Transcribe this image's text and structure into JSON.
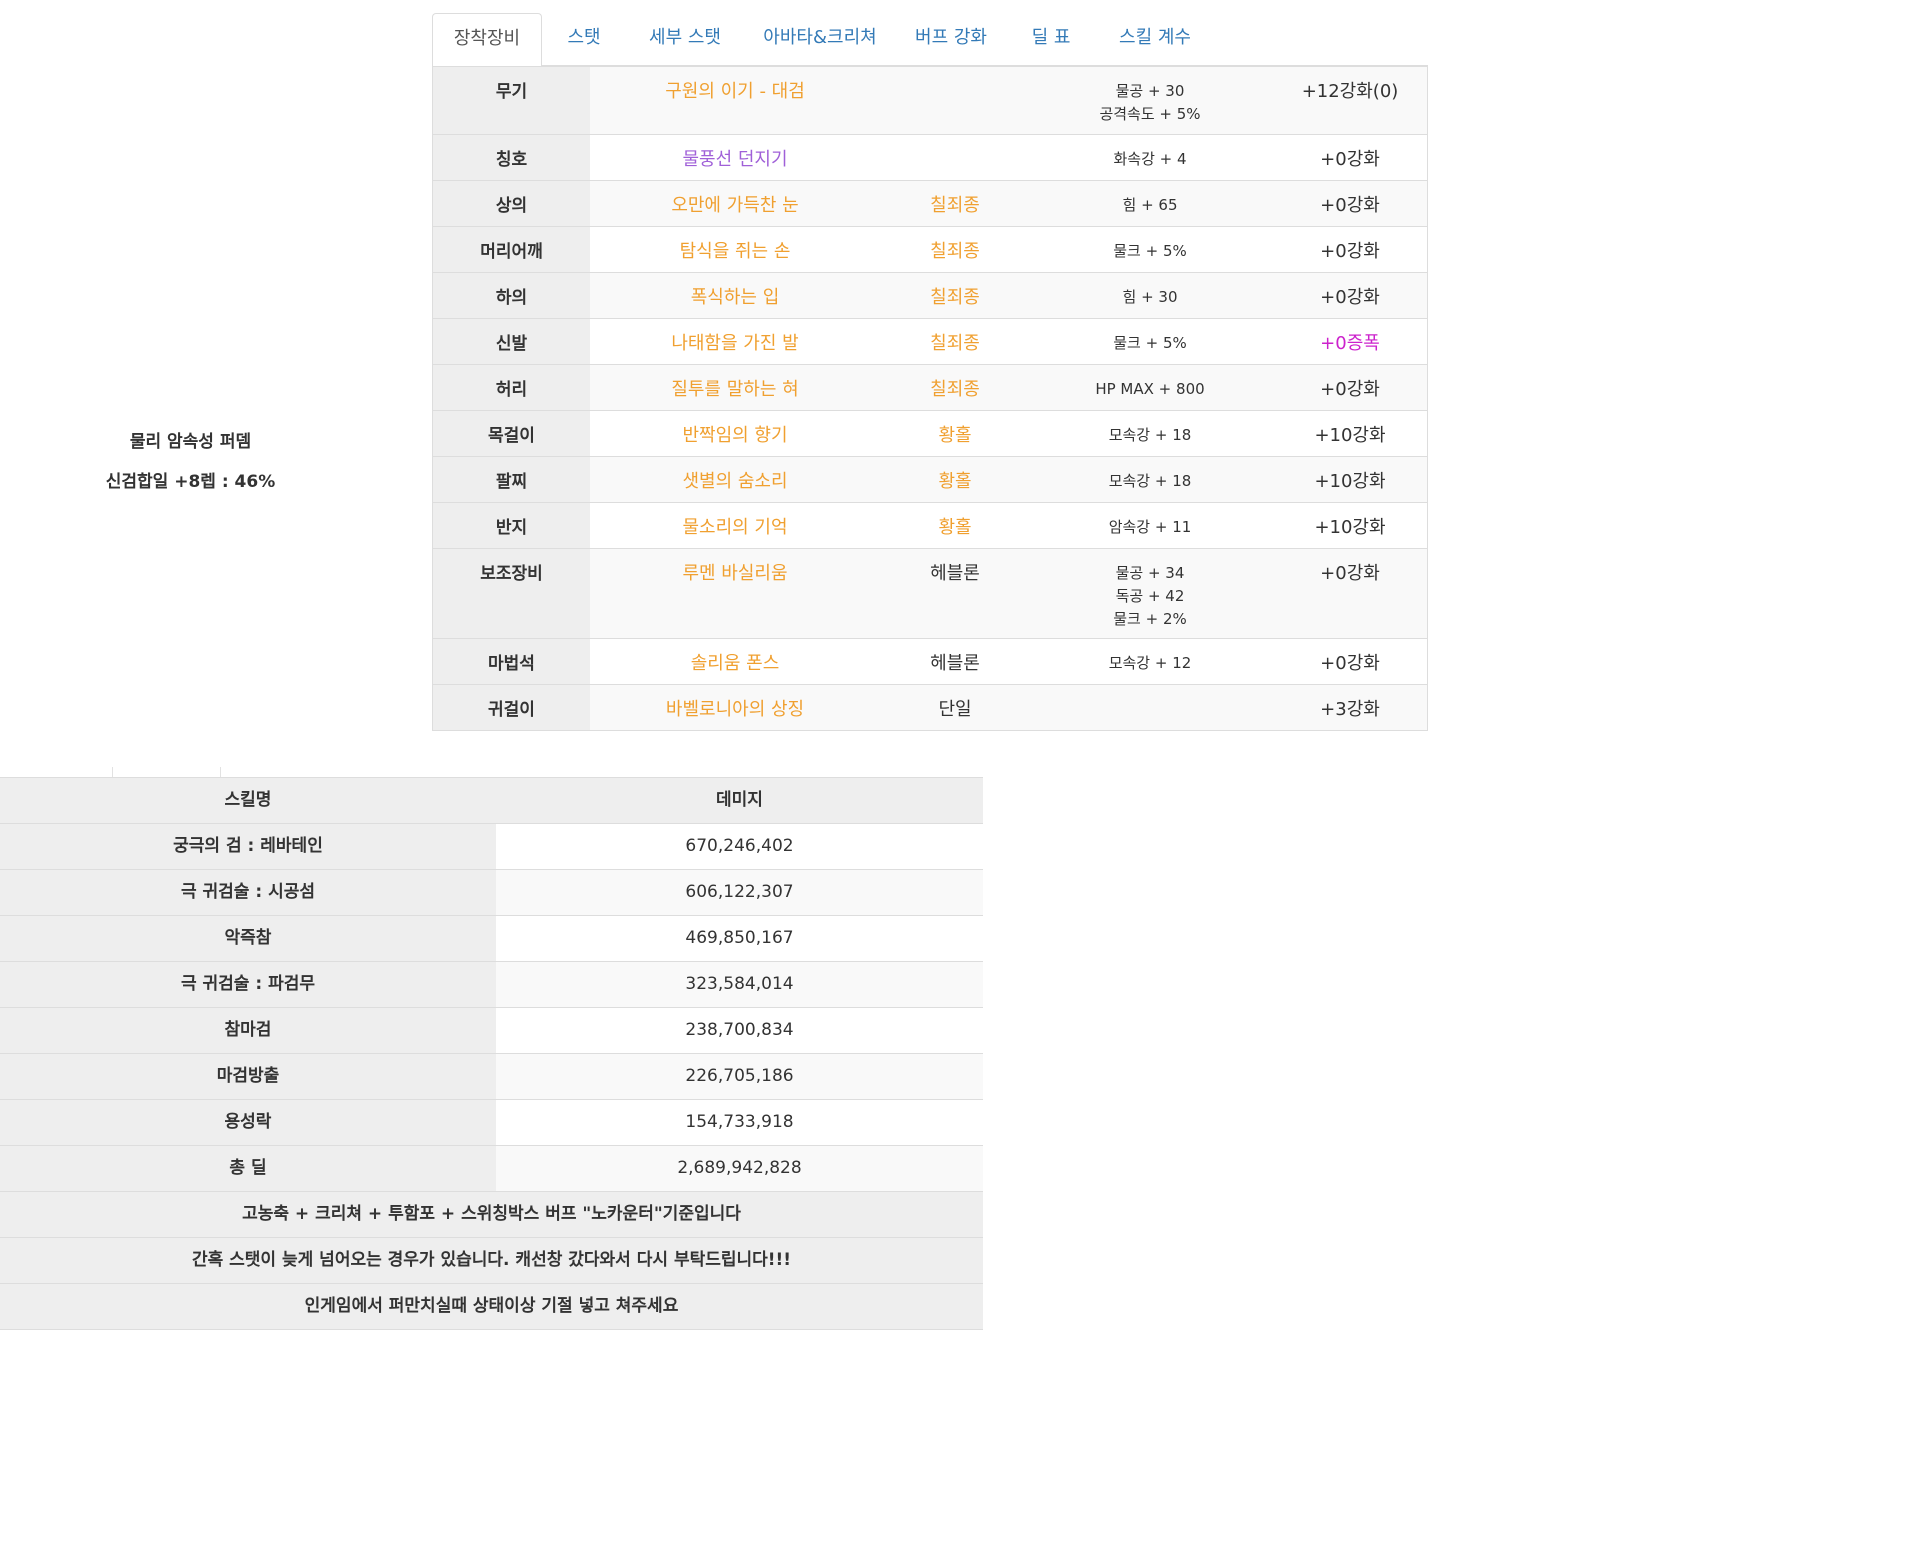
{
  "side_info": {
    "line1": "물리 암속성 퍼뎀",
    "line2": "신검합일 +8렙 : 46%"
  },
  "tabs": [
    {
      "label": "장착장비",
      "active": true
    },
    {
      "label": "스탯",
      "active": false
    },
    {
      "label": "세부 스탯",
      "active": false
    },
    {
      "label": "아바타&크리쳐",
      "active": false
    },
    {
      "label": "버프 강화",
      "active": false
    },
    {
      "label": "딜 표",
      "active": false
    },
    {
      "label": "스킬 계수",
      "active": false
    }
  ],
  "equipment": [
    {
      "slot": "무기",
      "name": "구원의 이기 - 대검",
      "name_color": "#f0a030",
      "set": "",
      "stats": [
        "물공 + 30",
        "공격속도 + 5%"
      ],
      "upgrade": "+12강화(0)",
      "upgrade_color": "#333333"
    },
    {
      "slot": "칭호",
      "name": "물풍선 던지기",
      "name_color": "#a060d8",
      "set": "",
      "stats": [
        "화속강 + 4"
      ],
      "upgrade": "+0강화",
      "upgrade_color": "#333333"
    },
    {
      "slot": "상의",
      "name": "오만에 가득찬 눈",
      "name_color": "#f0a030",
      "set": "칠죄종",
      "set_color": "#f0a030",
      "stats": [
        "힘 + 65"
      ],
      "upgrade": "+0강화",
      "upgrade_color": "#333333"
    },
    {
      "slot": "머리어깨",
      "name": "탐식을 쥐는 손",
      "name_color": "#f0a030",
      "set": "칠죄종",
      "set_color": "#f0a030",
      "stats": [
        "물크 + 5%"
      ],
      "upgrade": "+0강화",
      "upgrade_color": "#333333"
    },
    {
      "slot": "하의",
      "name": "폭식하는 입",
      "name_color": "#f0a030",
      "set": "칠죄종",
      "set_color": "#f0a030",
      "stats": [
        "힘 + 30"
      ],
      "upgrade": "+0강화",
      "upgrade_color": "#333333"
    },
    {
      "slot": "신발",
      "name": "나태함을 가진 발",
      "name_color": "#f0a030",
      "set": "칠죄종",
      "set_color": "#f0a030",
      "stats": [
        "물크 + 5%"
      ],
      "upgrade": "+0증폭",
      "upgrade_color": "#cc22cc"
    },
    {
      "slot": "허리",
      "name": "질투를 말하는 혀",
      "name_color": "#f0a030",
      "set": "칠죄종",
      "set_color": "#f0a030",
      "stats": [
        "HP MAX + 800"
      ],
      "upgrade": "+0강화",
      "upgrade_color": "#333333"
    },
    {
      "slot": "목걸이",
      "name": "반짝임의 향기",
      "name_color": "#f0a030",
      "set": "황홀",
      "set_color": "#f0a030",
      "stats": [
        "모속강 + 18"
      ],
      "upgrade": "+10강화",
      "upgrade_color": "#333333"
    },
    {
      "slot": "팔찌",
      "name": "샛별의 숨소리",
      "name_color": "#f0a030",
      "set": "황홀",
      "set_color": "#f0a030",
      "stats": [
        "모속강 + 18"
      ],
      "upgrade": "+10강화",
      "upgrade_color": "#333333"
    },
    {
      "slot": "반지",
      "name": "물소리의 기억",
      "name_color": "#f0a030",
      "set": "황홀",
      "set_color": "#f0a030",
      "stats": [
        "암속강 + 11"
      ],
      "upgrade": "+10강화",
      "upgrade_color": "#333333"
    },
    {
      "slot": "보조장비",
      "name": "루멘 바실리움",
      "name_color": "#f0a030",
      "set": "헤블론",
      "set_color": "#333333",
      "stats": [
        "물공 + 34",
        "독공 + 42",
        "물크 + 2%"
      ],
      "upgrade": "+0강화",
      "upgrade_color": "#333333"
    },
    {
      "slot": "마법석",
      "name": "솔리움 폰스",
      "name_color": "#f0a030",
      "set": "헤블론",
      "set_color": "#333333",
      "stats": [
        "모속강 + 12"
      ],
      "upgrade": "+0강화",
      "upgrade_color": "#333333"
    },
    {
      "slot": "귀걸이",
      "name": "바벨로니아의 상징",
      "name_color": "#f0a030",
      "set": "단일",
      "set_color": "#333333",
      "stats": [],
      "upgrade": "+3강화",
      "upgrade_color": "#333333"
    }
  ],
  "damage_table": {
    "header": {
      "skill": "스킬명",
      "damage": "데미지"
    },
    "rows": [
      {
        "skill": "궁극의 검 : 레바테인",
        "damage": "670,246,402"
      },
      {
        "skill": "극 귀검술 : 시공섬",
        "damage": "606,122,307"
      },
      {
        "skill": "악즉참",
        "damage": "469,850,167"
      },
      {
        "skill": "극 귀검술 : 파검무",
        "damage": "323,584,014"
      },
      {
        "skill": "참마검",
        "damage": "238,700,834"
      },
      {
        "skill": "마검방출",
        "damage": "226,705,186"
      },
      {
        "skill": "용성락",
        "damage": "154,733,918"
      },
      {
        "skill": "총 딜",
        "damage": "2,689,942,828"
      }
    ],
    "notes": [
      "고농축 + 크리쳐 + 투함포 + 스위칭박스 버프 \"노카운터\"기준입니다",
      "간혹 스탯이 늦게 넘어오는 경우가 있습니다. 캐선창 갔다와서 다시 부탁드립니다!!!",
      "인게임에서 퍼만치실때 상태이상 기절 넣고 쳐주세요"
    ]
  }
}
